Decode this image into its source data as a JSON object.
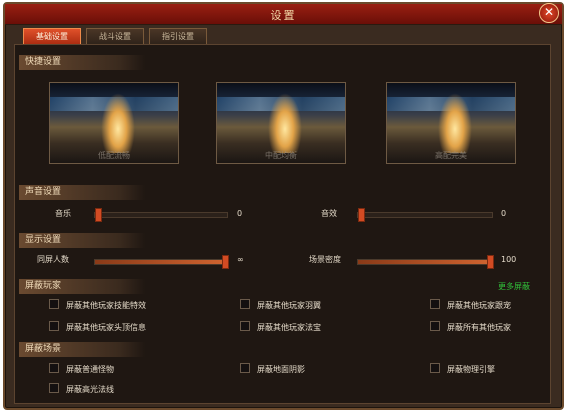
{
  "window": {
    "title": "设置"
  },
  "tabs": [
    {
      "label": "基础设置",
      "active": true
    },
    {
      "label": "战斗设置",
      "active": false
    },
    {
      "label": "指引设置",
      "active": false
    }
  ],
  "quick": {
    "header": "快捷设置",
    "presets": [
      {
        "label": "低配流畅"
      },
      {
        "label": "中配均衡"
      },
      {
        "label": "高配完美"
      }
    ]
  },
  "sound": {
    "header": "声音设置",
    "music": {
      "label": "音乐",
      "value": "0",
      "level": 0
    },
    "effects": {
      "label": "音效",
      "value": "0",
      "level": 0
    }
  },
  "display": {
    "header": "显示设置",
    "players": {
      "label": "同屏人数",
      "value": "∞",
      "level": 1
    },
    "density": {
      "label": "场景密度",
      "value": "100",
      "level": 1
    }
  },
  "hide_players": {
    "header": "屏蔽玩家",
    "more_label": "更多屏蔽",
    "options": [
      "屏蔽其他玩家技能特效",
      "屏蔽其他玩家羽翼",
      "屏蔽其他玩家跟宠",
      "屏蔽其他玩家头顶信息",
      "屏蔽其他玩家法宝",
      "屏蔽所有其他玩家"
    ]
  },
  "hide_scene": {
    "header": "屏蔽场景",
    "options": [
      "屏蔽普通怪物",
      "屏蔽地面阴影",
      "屏蔽物理引擎",
      "屏蔽高光法线"
    ]
  },
  "colors": {
    "accent": "#d24b23",
    "more_link": "#31c23a",
    "title_bar": "#7a150c"
  },
  "icons": {
    "close": "close-icon"
  }
}
